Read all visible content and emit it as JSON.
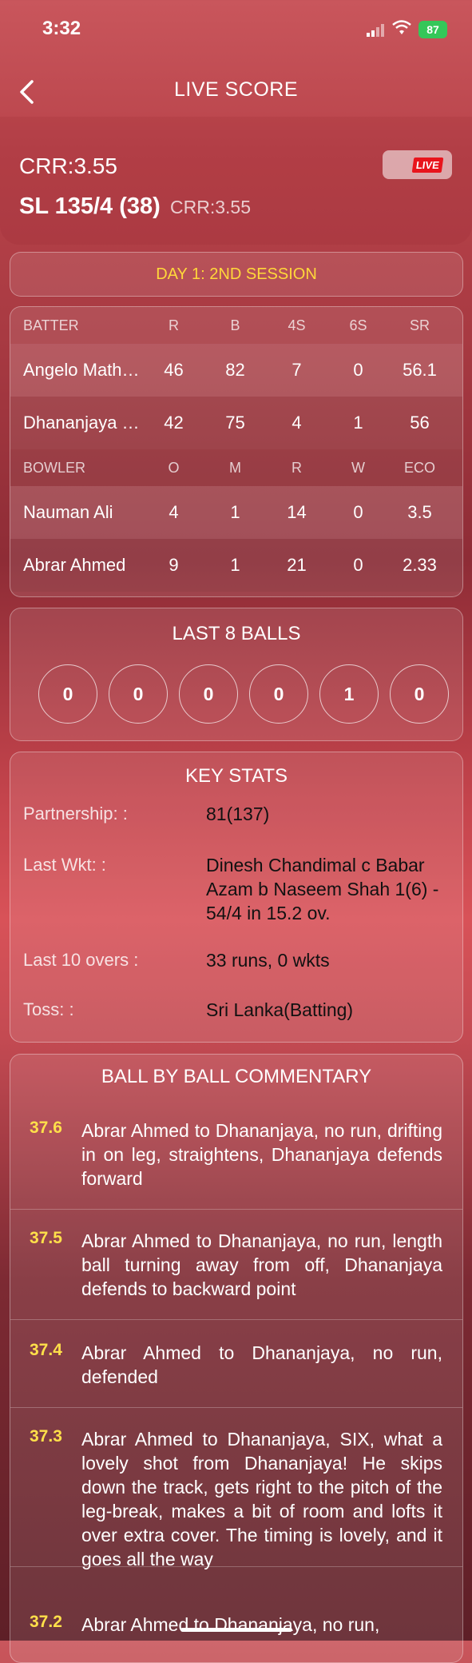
{
  "status_bar": {
    "time": "3:32",
    "battery": "87"
  },
  "nav": {
    "title": "LIVE SCORE"
  },
  "score_header": {
    "crr_top": "CRR:3.55",
    "live_badge": "LIVE",
    "score": "SL 135/4 (38)",
    "crr_sub": "CRR:3.55"
  },
  "session": "DAY 1: 2ND SESSION",
  "batting": {
    "headers": [
      "BATTER",
      "R",
      "B",
      "4S",
      "6S",
      "SR"
    ],
    "rows": [
      [
        "Angelo Math…",
        "46",
        "82",
        "7",
        "0",
        "56.1"
      ],
      [
        "Dhananjaya …",
        "42",
        "75",
        "4",
        "1",
        "56"
      ]
    ]
  },
  "bowling": {
    "headers": [
      "BOWLER",
      "O",
      "M",
      "R",
      "W",
      "ECO"
    ],
    "rows": [
      [
        "Nauman Ali",
        "4",
        "1",
        "14",
        "0",
        "3.5"
      ],
      [
        "Abrar Ahmed",
        "9",
        "1",
        "21",
        "0",
        "2.33"
      ]
    ]
  },
  "last_balls": {
    "title": "LAST 8 BALLS",
    "balls": [
      "0",
      "0",
      "0",
      "0",
      "1",
      "0"
    ]
  },
  "key_stats": {
    "title": "KEY STATS",
    "items": [
      {
        "label": "Partnership:  :",
        "value": "81(137)"
      },
      {
        "label": "Last Wkt:  :",
        "value": "Dinesh Chandimal c Babar Azam b Naseem Shah 1(6) - 54/4 in 15.2 ov."
      },
      {
        "label": "Last 10 overs  :",
        "value": "33 runs, 0 wkts"
      },
      {
        "label": "Toss:  :",
        "value": "Sri Lanka(Batting)"
      }
    ]
  },
  "commentary": {
    "title": "BALL BY BALL COMMENTARY",
    "items": [
      {
        "over": "37.6",
        "text": "Abrar Ahmed to Dhananjaya, no run, drifting in on leg, straightens, Dhananjaya defends forward"
      },
      {
        "over": "37.5",
        "text": "Abrar Ahmed to Dhananjaya, no run, length ball turning away from off, Dhananjaya defends to backward point"
      },
      {
        "over": "37.4",
        "text": "Abrar Ahmed to Dhananjaya, no run, defended"
      },
      {
        "over": "37.3",
        "text": "Abrar Ahmed to Dhananjaya, SIX, what a lovely shot from Dhananjaya! He skips down the track, gets right to the pitch of the leg-break, makes a bit of room and lofts it over extra cover. The timing is lovely, and it goes all the way"
      },
      {
        "over": "37.2",
        "text": "Abrar Ahmed to Dhananjaya, no run,"
      }
    ]
  }
}
